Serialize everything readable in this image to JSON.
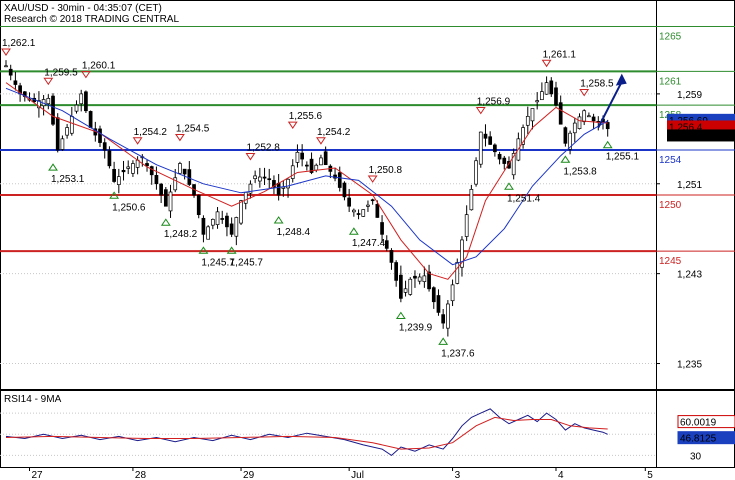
{
  "chart_data": [
    {
      "type": "candlestick",
      "header": "XAU/USD - 30min - 04:35:07 (CET)",
      "subheader": "Research © 2018 TRADING CENTRAL",
      "ylim": [
        1233,
        1267
      ],
      "yticks": [
        "1,259",
        "1,251",
        "1,243",
        "1,235"
      ],
      "price_badges": [
        {
          "label": "1,256.69",
          "value": 1256.69,
          "bg": "#1a3fbf",
          "fg": "#ffffff"
        },
        {
          "label": "1,256.4",
          "value": 1256.1,
          "bg": "#cc0000",
          "fg": "#ffffff"
        },
        {
          "label": "1,255.87",
          "value": 1255.3,
          "bg": "#000000",
          "fg": "#ffffff"
        }
      ],
      "levels": [
        {
          "value": 1265,
          "label": "1265",
          "color": "#2e8b2e",
          "width": 1
        },
        {
          "value": 1261,
          "label": "1261",
          "color": "#2e8b2e",
          "width": 2
        },
        {
          "value": 1258,
          "label": "1258",
          "color": "#2e8b2e",
          "width": 2
        },
        {
          "value": 1254,
          "label": "1254",
          "color": "#1a34c8",
          "width": 2
        },
        {
          "value": 1250,
          "label": "1250",
          "color": "#cc2222",
          "width": 2
        },
        {
          "value": 1245,
          "label": "1245",
          "color": "#cc2222",
          "width": 2
        }
      ],
      "annotations": [
        {
          "text": "1,262.1",
          "i": 0,
          "v": 1262.1,
          "kind": "high"
        },
        {
          "text": "1,259.5",
          "i": 9,
          "v": 1259.5,
          "kind": "high"
        },
        {
          "text": "1,260.1",
          "i": 17,
          "v": 1260.1,
          "kind": "high"
        },
        {
          "text": "1,253.1",
          "i": 10,
          "v": 1253.1,
          "kind": "low"
        },
        {
          "text": "1,254.2",
          "i": 28,
          "v": 1254.2,
          "kind": "high"
        },
        {
          "text": "1,254.5",
          "i": 37,
          "v": 1254.5,
          "kind": "high"
        },
        {
          "text": "1,250.6",
          "i": 23,
          "v": 1250.6,
          "kind": "low"
        },
        {
          "text": "1,248.2",
          "i": 34,
          "v": 1248.2,
          "kind": "low"
        },
        {
          "text": "1,245.7",
          "i": 42,
          "v": 1245.7,
          "kind": "low"
        },
        {
          "text": "1,245.7",
          "i": 48,
          "v": 1245.7,
          "kind": "low"
        },
        {
          "text": "1,252.8",
          "i": 52,
          "v": 1252.8,
          "kind": "high"
        },
        {
          "text": "1,255.6",
          "i": 61,
          "v": 1255.6,
          "kind": "high"
        },
        {
          "text": "1,254.2",
          "i": 67,
          "v": 1254.2,
          "kind": "high"
        },
        {
          "text": "1,248.4",
          "i": 58,
          "v": 1248.4,
          "kind": "low"
        },
        {
          "text": "1,250.8",
          "i": 78,
          "v": 1250.8,
          "kind": "high"
        },
        {
          "text": "1,247.4",
          "i": 74,
          "v": 1247.4,
          "kind": "low"
        },
        {
          "text": "1,239.9",
          "i": 84,
          "v": 1239.9,
          "kind": "low"
        },
        {
          "text": "1,237.6",
          "i": 93,
          "v": 1237.6,
          "kind": "low"
        },
        {
          "text": "1,256.9",
          "i": 101,
          "v": 1256.9,
          "kind": "high"
        },
        {
          "text": "1,251.4",
          "i": 107,
          "v": 1251.4,
          "kind": "low"
        },
        {
          "text": "1,261.1",
          "i": 115,
          "v": 1261.1,
          "kind": "high"
        },
        {
          "text": "1,258.5",
          "i": 123,
          "v": 1258.5,
          "kind": "high"
        },
        {
          "text": "1,253.8",
          "i": 119,
          "v": 1253.8,
          "kind": "low"
        },
        {
          "text": "1,255.1",
          "i": 128,
          "v": 1255.1,
          "kind": "low"
        }
      ],
      "forecast_arrow": {
        "from_i": 126,
        "from_v": 1256.0,
        "to_i": 131,
        "to_v": 1260.8,
        "color": "#0b1f8a"
      },
      "close_points": [
        [
          0,
          1261.5
        ],
        [
          3,
          1259.0
        ],
        [
          6,
          1258.3
        ],
        [
          9,
          1258.6
        ],
        [
          11,
          1254.0
        ],
        [
          13,
          1256.0
        ],
        [
          16,
          1259.0
        ],
        [
          18,
          1256.0
        ],
        [
          21,
          1254.0
        ],
        [
          23,
          1251.2
        ],
        [
          26,
          1252.5
        ],
        [
          29,
          1253.4
        ],
        [
          32,
          1251.0
        ],
        [
          34,
          1249.0
        ],
        [
          37,
          1252.8
        ],
        [
          40,
          1250.0
        ],
        [
          42,
          1246.5
        ],
        [
          45,
          1248.5
        ],
        [
          48,
          1246.5
        ],
        [
          50,
          1249.5
        ],
        [
          53,
          1251.7
        ],
        [
          56,
          1251.4
        ],
        [
          58,
          1250.0
        ],
        [
          60,
          1251.4
        ],
        [
          62,
          1253.8
        ],
        [
          65,
          1252.0
        ],
        [
          67,
          1253.3
        ],
        [
          70,
          1251.5
        ],
        [
          73,
          1249.0
        ],
        [
          75,
          1248.3
        ],
        [
          78,
          1249.5
        ],
        [
          80,
          1246.5
        ],
        [
          82,
          1244.0
        ],
        [
          84,
          1240.8
        ],
        [
          86,
          1242.5
        ],
        [
          89,
          1242.8
        ],
        [
          91,
          1240.5
        ],
        [
          93,
          1238.6
        ],
        [
          95,
          1242.0
        ],
        [
          97,
          1246.0
        ],
        [
          99,
          1250.5
        ],
        [
          101,
          1255.6
        ],
        [
          103,
          1254.5
        ],
        [
          105,
          1253.2
        ],
        [
          107,
          1252.4
        ],
        [
          109,
          1255.0
        ],
        [
          111,
          1257.0
        ],
        [
          113,
          1258.4
        ],
        [
          115,
          1260.0
        ],
        [
          117,
          1258.0
        ],
        [
          119,
          1254.6
        ],
        [
          121,
          1256.4
        ],
        [
          123,
          1257.5
        ],
        [
          125,
          1256.6
        ],
        [
          127,
          1256.5
        ],
        [
          128,
          1255.9
        ]
      ],
      "ma_fast": [
        [
          0,
          1260.0
        ],
        [
          10,
          1257.0
        ],
        [
          20,
          1255.5
        ],
        [
          30,
          1252.5
        ],
        [
          40,
          1250.5
        ],
        [
          48,
          1249.0
        ],
        [
          55,
          1250.3
        ],
        [
          62,
          1252.0
        ],
        [
          70,
          1252.4
        ],
        [
          78,
          1250.0
        ],
        [
          84,
          1246.0
        ],
        [
          90,
          1243.0
        ],
        [
          94,
          1242.5
        ],
        [
          98,
          1244.5
        ],
        [
          102,
          1249.5
        ],
        [
          107,
          1252.8
        ],
        [
          112,
          1256.0
        ],
        [
          117,
          1257.8
        ],
        [
          122,
          1256.6
        ],
        [
          128,
          1256.4
        ]
      ],
      "ma_slow": [
        [
          0,
          1259.5
        ],
        [
          12,
          1257.5
        ],
        [
          22,
          1255.0
        ],
        [
          32,
          1252.7
        ],
        [
          42,
          1251.0
        ],
        [
          50,
          1250.2
        ],
        [
          60,
          1250.8
        ],
        [
          68,
          1251.7
        ],
        [
          75,
          1251.3
        ],
        [
          82,
          1249.0
        ],
        [
          88,
          1246.0
        ],
        [
          95,
          1243.8
        ],
        [
          100,
          1244.5
        ],
        [
          106,
          1247.0
        ],
        [
          112,
          1250.8
        ],
        [
          118,
          1253.5
        ],
        [
          123,
          1255.4
        ],
        [
          128,
          1256.6
        ]
      ],
      "n_bars": 129
    },
    {
      "type": "line",
      "title": "RSI14 - 9MA",
      "ylim": [
        20,
        90
      ],
      "levels": [
        {
          "value": 70
        },
        {
          "value": 30
        },
        {
          "value": 50
        }
      ],
      "badges": [
        {
          "label": "60.0019",
          "value": 62,
          "bg": "#ffffff",
          "fg": "#cc0000",
          "border": "#cc0000"
        },
        {
          "label": "46.8125",
          "value": 46.8,
          "bg": "#1a3fbf",
          "fg": "#ffffff",
          "border": "#1a3fbf"
        }
      ],
      "yticks": [
        {
          "label": "30",
          "value": 30
        }
      ],
      "rsi_points": [
        [
          0,
          48
        ],
        [
          4,
          46
        ],
        [
          8,
          50
        ],
        [
          12,
          46
        ],
        [
          16,
          49
        ],
        [
          20,
          45
        ],
        [
          24,
          48
        ],
        [
          28,
          44
        ],
        [
          32,
          47
        ],
        [
          36,
          43
        ],
        [
          40,
          47
        ],
        [
          44,
          44
        ],
        [
          48,
          49
        ],
        [
          52,
          45
        ],
        [
          56,
          50
        ],
        [
          60,
          47
        ],
        [
          64,
          51
        ],
        [
          68,
          48
        ],
        [
          72,
          45
        ],
        [
          76,
          40
        ],
        [
          80,
          36
        ],
        [
          82,
          30
        ],
        [
          84,
          38
        ],
        [
          87,
          34
        ],
        [
          90,
          40
        ],
        [
          93,
          36
        ],
        [
          95,
          46
        ],
        [
          97,
          58
        ],
        [
          99,
          66
        ],
        [
          101,
          70
        ],
        [
          103,
          74
        ],
        [
          105,
          66
        ],
        [
          107,
          60
        ],
        [
          109,
          64
        ],
        [
          111,
          68
        ],
        [
          113,
          62
        ],
        [
          115,
          70
        ],
        [
          117,
          64
        ],
        [
          119,
          54
        ],
        [
          121,
          60
        ],
        [
          123,
          56
        ],
        [
          125,
          54
        ],
        [
          127,
          52
        ],
        [
          128,
          50
        ]
      ],
      "ma_points": [
        [
          0,
          47
        ],
        [
          10,
          48
        ],
        [
          20,
          47
        ],
        [
          30,
          46
        ],
        [
          40,
          46
        ],
        [
          50,
          47
        ],
        [
          60,
          48
        ],
        [
          70,
          47
        ],
        [
          78,
          42
        ],
        [
          84,
          36
        ],
        [
          90,
          37
        ],
        [
          95,
          42
        ],
        [
          100,
          58
        ],
        [
          104,
          66
        ],
        [
          108,
          63
        ],
        [
          112,
          64
        ],
        [
          116,
          64
        ],
        [
          120,
          58
        ],
        [
          124,
          56
        ],
        [
          128,
          55
        ]
      ],
      "x_labels": [
        {
          "label": "27",
          "i": 5
        },
        {
          "label": "28",
          "i": 27
        },
        {
          "label": "29",
          "i": 50
        },
        {
          "label": "Jul",
          "i": 73
        },
        {
          "label": "3",
          "i": 95
        },
        {
          "label": "4",
          "i": 117
        },
        {
          "label": "5",
          "i": 136
        }
      ]
    }
  ]
}
